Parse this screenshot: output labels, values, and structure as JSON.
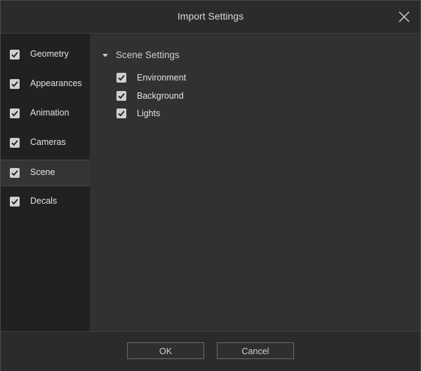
{
  "window": {
    "title": "Import Settings"
  },
  "sidebar": {
    "items": [
      {
        "label": "Geometry",
        "checked": true
      },
      {
        "label": "Appearances",
        "checked": true
      },
      {
        "label": "Animation",
        "checked": true
      },
      {
        "label": "Cameras",
        "checked": true
      },
      {
        "label": "Scene",
        "checked": true,
        "selected": true
      },
      {
        "label": "Decals",
        "checked": true
      }
    ]
  },
  "content": {
    "section_title": "Scene Settings",
    "options": [
      {
        "label": "Environment",
        "checked": true
      },
      {
        "label": "Background",
        "checked": true
      },
      {
        "label": "Lights",
        "checked": true
      }
    ]
  },
  "footer": {
    "ok_label": "OK",
    "cancel_label": "Cancel"
  },
  "colors": {
    "background": "#2f2f2f",
    "sidebar": "#212121",
    "selected_item": "#343434",
    "checkbox": "#d0d0d0",
    "checkmark": "#1e1e1e"
  },
  "icons": {
    "close": "close-icon",
    "caret": "caret-down-icon",
    "check": "checkmark-icon"
  }
}
